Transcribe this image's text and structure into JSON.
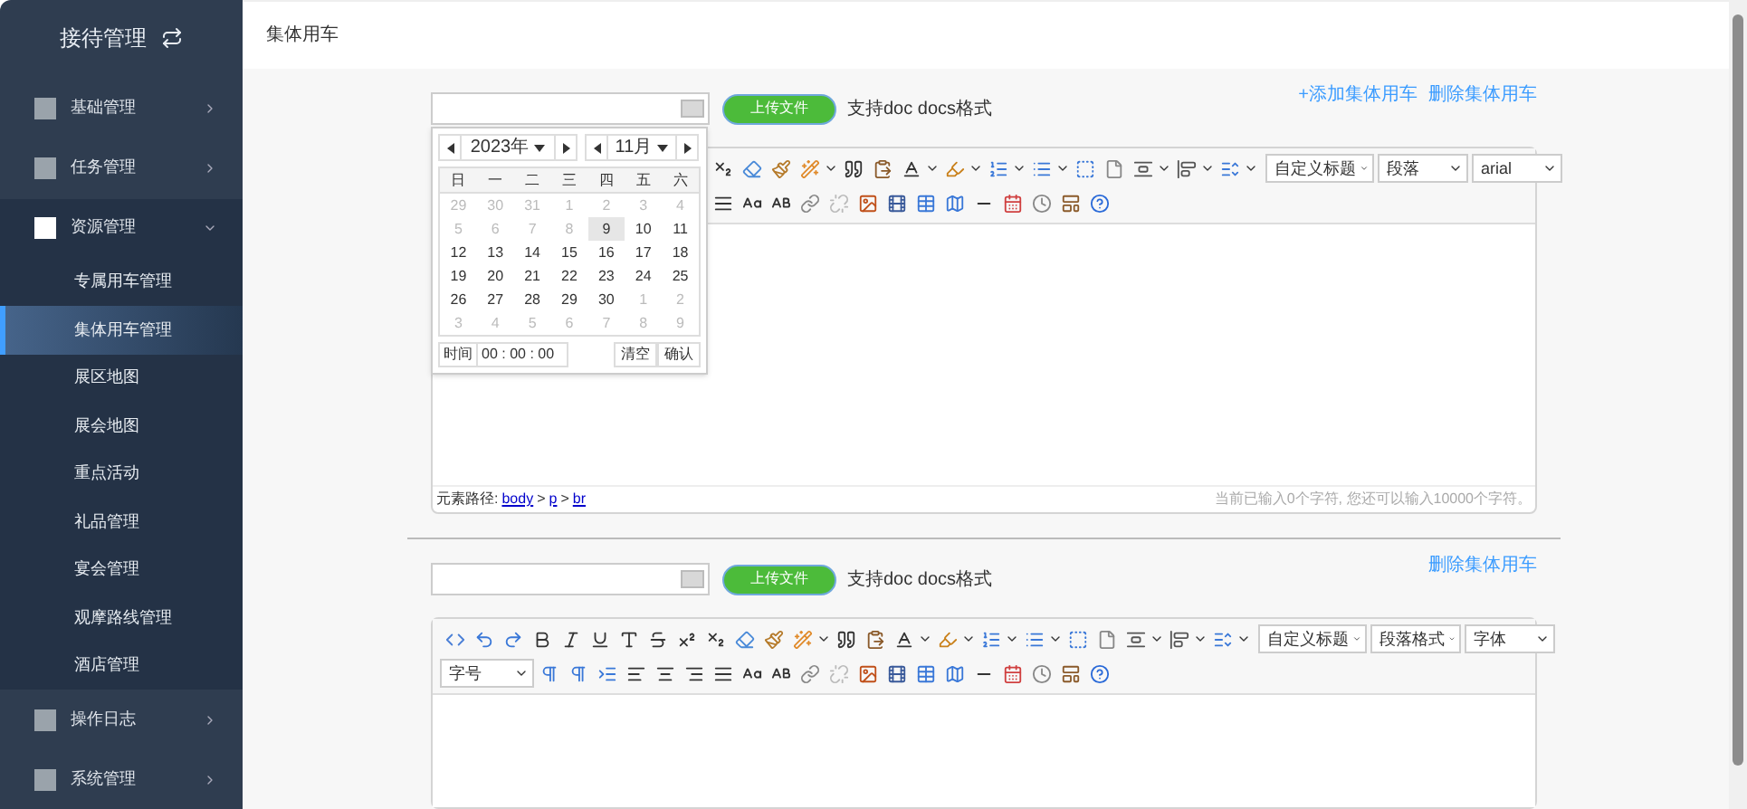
{
  "sidebar": {
    "title": "接待管理",
    "items": [
      {
        "label": "基础管理",
        "expanded": false
      },
      {
        "label": "任务管理",
        "expanded": false
      },
      {
        "label": "资源管理",
        "expanded": true,
        "children": [
          {
            "label": "专属用车管理",
            "selected": false
          },
          {
            "label": "集体用车管理",
            "selected": true
          },
          {
            "label": "展区地图",
            "selected": false
          },
          {
            "label": "展会地图",
            "selected": false
          },
          {
            "label": "重点活动",
            "selected": false
          },
          {
            "label": "礼品管理",
            "selected": false
          },
          {
            "label": "宴会管理",
            "selected": false
          },
          {
            "label": "观摩路线管理",
            "selected": false
          },
          {
            "label": "酒店管理",
            "selected": false
          }
        ]
      },
      {
        "label": "操作日志",
        "expanded": false
      },
      {
        "label": "系统管理",
        "expanded": false
      }
    ]
  },
  "header": {
    "title": "集体用车"
  },
  "blocks": [
    {
      "upload_button": "上传文件",
      "format_note": "支持doc docs格式",
      "links": [
        "+添加集体用车",
        "删除集体用车"
      ],
      "date_picker": {
        "year": "2023年",
        "month": "11月",
        "weekdays": [
          "日",
          "一",
          "二",
          "三",
          "四",
          "五",
          "六"
        ],
        "days": [
          {
            "label": "29",
            "current": false,
            "selected": false
          },
          {
            "label": "30",
            "current": false,
            "selected": false
          },
          {
            "label": "31",
            "current": false,
            "selected": false
          },
          {
            "label": "1",
            "current": false,
            "selected": false
          },
          {
            "label": "2",
            "current": false,
            "selected": false
          },
          {
            "label": "3",
            "current": false,
            "selected": false
          },
          {
            "label": "4",
            "current": false,
            "selected": false
          },
          {
            "label": "5",
            "current": false,
            "selected": false
          },
          {
            "label": "6",
            "current": false,
            "selected": false
          },
          {
            "label": "7",
            "current": false,
            "selected": false
          },
          {
            "label": "8",
            "current": false,
            "selected": false
          },
          {
            "label": "9",
            "current": true,
            "selected": true
          },
          {
            "label": "10",
            "current": true,
            "selected": false
          },
          {
            "label": "11",
            "current": true,
            "selected": false
          },
          {
            "label": "12",
            "current": true,
            "selected": false
          },
          {
            "label": "13",
            "current": true,
            "selected": false
          },
          {
            "label": "14",
            "current": true,
            "selected": false
          },
          {
            "label": "15",
            "current": true,
            "selected": false
          },
          {
            "label": "16",
            "current": true,
            "selected": false
          },
          {
            "label": "17",
            "current": true,
            "selected": false
          },
          {
            "label": "18",
            "current": true,
            "selected": false
          },
          {
            "label": "19",
            "current": true,
            "selected": false
          },
          {
            "label": "20",
            "current": true,
            "selected": false
          },
          {
            "label": "21",
            "current": true,
            "selected": false
          },
          {
            "label": "22",
            "current": true,
            "selected": false
          },
          {
            "label": "23",
            "current": true,
            "selected": false
          },
          {
            "label": "24",
            "current": true,
            "selected": false
          },
          {
            "label": "25",
            "current": true,
            "selected": false
          },
          {
            "label": "26",
            "current": true,
            "selected": false
          },
          {
            "label": "27",
            "current": true,
            "selected": false
          },
          {
            "label": "28",
            "current": true,
            "selected": false
          },
          {
            "label": "29",
            "current": true,
            "selected": false
          },
          {
            "label": "30",
            "current": true,
            "selected": false
          },
          {
            "label": "1",
            "current": false,
            "selected": false
          },
          {
            "label": "2",
            "current": false,
            "selected": false
          },
          {
            "label": "3",
            "current": false,
            "selected": false
          },
          {
            "label": "4",
            "current": false,
            "selected": false
          },
          {
            "label": "5",
            "current": false,
            "selected": false
          },
          {
            "label": "6",
            "current": false,
            "selected": false
          },
          {
            "label": "7",
            "current": false,
            "selected": false
          },
          {
            "label": "8",
            "current": false,
            "selected": false
          },
          {
            "label": "9",
            "current": false,
            "selected": false
          }
        ],
        "time_label": "时间",
        "time_value": "00 : 00 : 00",
        "buttons": [
          "清空",
          "确认"
        ]
      },
      "editor": {
        "row1_selects": [
          "自定义标题",
          "段落",
          "arial"
        ],
        "status": {
          "path_label": "元素路径:",
          "path": [
            "body",
            "p",
            "br"
          ],
          "path_separators": [
            ">",
            ">"
          ],
          "count": "当前已输入0个字符, 您还可以输入10000个字符。"
        }
      }
    },
    {
      "upload_button": "上传文件",
      "format_note": "支持doc docs格式",
      "links": [
        "删除集体用车"
      ],
      "editor": {
        "row1_selects": [
          "自定义标题",
          "段落格式",
          "字体"
        ],
        "row2_selects": [
          "字号"
        ]
      }
    }
  ]
}
